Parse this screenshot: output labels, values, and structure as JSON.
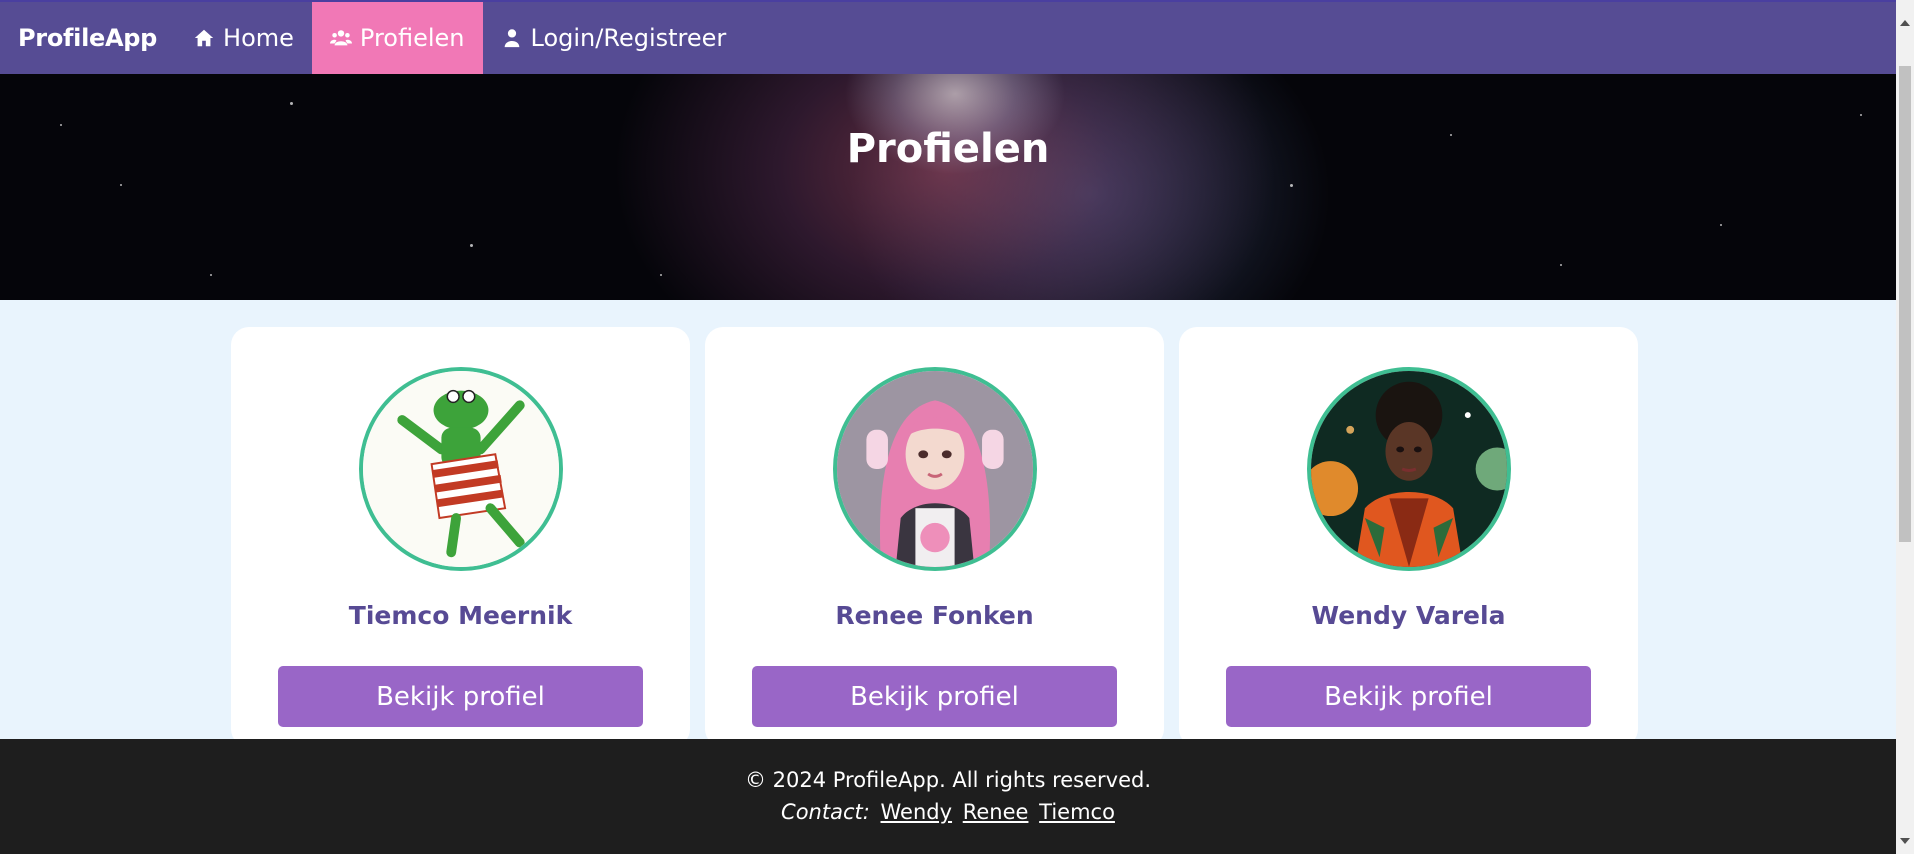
{
  "nav": {
    "brand": "ProfileApp",
    "items": [
      {
        "label": "Home",
        "icon": "home-icon",
        "active": false
      },
      {
        "label": "Profielen",
        "icon": "users-icon",
        "active": true
      },
      {
        "label": "Login/Registreer",
        "icon": "user-icon",
        "active": false
      }
    ]
  },
  "hero": {
    "title": "Profielen"
  },
  "profiles": [
    {
      "name": "Tiemco Meernik",
      "button": "Bekijk profiel",
      "avatar": "frog-avatar"
    },
    {
      "name": "Renee Fonken",
      "button": "Bekijk profiel",
      "avatar": "pink-hair-girl-avatar"
    },
    {
      "name": "Wendy Varela",
      "button": "Bekijk profiel",
      "avatar": "space-woman-avatar"
    }
  ],
  "footer": {
    "copyright": "© 2024 ProfileApp. All rights reserved.",
    "contact_label": "Contact:",
    "links": [
      "Wendy",
      "Renee",
      "Tiemco"
    ]
  },
  "colors": {
    "nav_bg": "#564c94",
    "nav_active": "#f178b6",
    "accent_button": "#9966c7",
    "name_text": "#574a94",
    "avatar_border": "#3fbe92",
    "page_bg": "#e9f4fd",
    "footer_bg": "#1e1e1e"
  }
}
